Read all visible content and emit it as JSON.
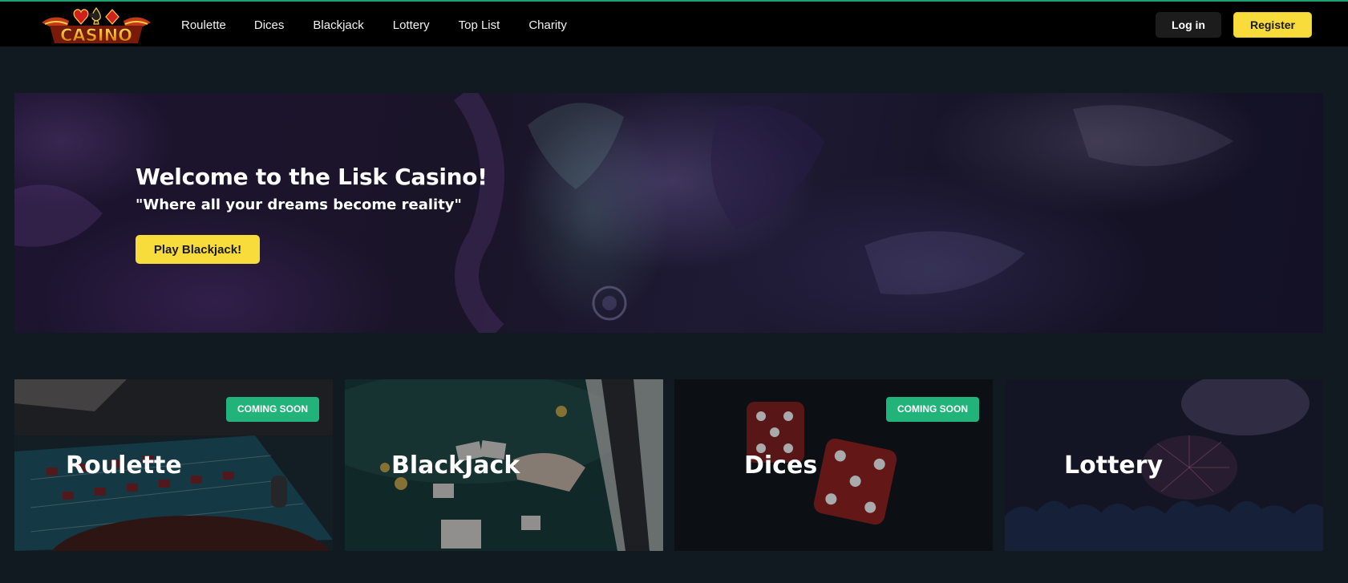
{
  "brand": {
    "logo_text": "CASINO",
    "accent": "#f8dc3c",
    "success": "#22b37a"
  },
  "nav": {
    "links": [
      "Roulette",
      "Dices",
      "Blackjack",
      "Lottery",
      "Top List",
      "Charity"
    ],
    "login_label": "Log in",
    "register_label": "Register"
  },
  "hero": {
    "title": "Welcome to the Lisk Casino!",
    "subtitle": "\"Where all your dreams become reality\"",
    "cta_label": "Play Blackjack!"
  },
  "cards": [
    {
      "title": "Roulette",
      "badge": "COMING SOON"
    },
    {
      "title": "BlackJack",
      "badge": ""
    },
    {
      "title": "Dices",
      "badge": "COMING SOON"
    },
    {
      "title": "Lottery",
      "badge": ""
    }
  ]
}
